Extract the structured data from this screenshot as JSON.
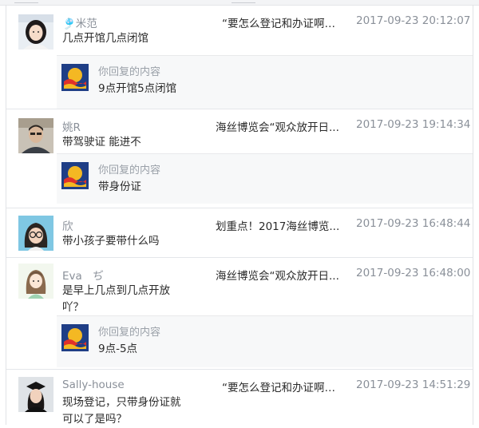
{
  "comments": [
    {
      "username": "🎐米范",
      "text": "几点开馆几点闭馆",
      "article": "“要怎么登记和办证啊？...",
      "time": "2017-09-23 20:12:07",
      "reply": {
        "label": "你回复的内容",
        "text": "9点开馆5点闭馆"
      }
    },
    {
      "username": "姚R",
      "text": "带驾驶证 能进不",
      "article": "海丝博览会“观众放开日...",
      "time": "2017-09-23 19:14:34",
      "reply": {
        "label": "你回复的内容",
        "text": "带身份证"
      }
    },
    {
      "username": "欣",
      "text": "带小孩子要带什么吗",
      "article": "划重点！2017海丝博览...",
      "time": "2017-09-23 16:48:44"
    },
    {
      "username": "Eva　ぢ",
      "text": "是早上几点到几点开放吖？",
      "article": "海丝博览会“观众放开日...",
      "time": "2017-09-23 16:48:00",
      "reply": {
        "label": "你回复的内容",
        "text": "9点-5点"
      }
    },
    {
      "username": "Sally-house",
      "text": "现场登记，只带身份证就可以了是吗？",
      "article": "“要怎么登记和办证啊？...",
      "time": "2017-09-23 14:51:29"
    }
  ]
}
